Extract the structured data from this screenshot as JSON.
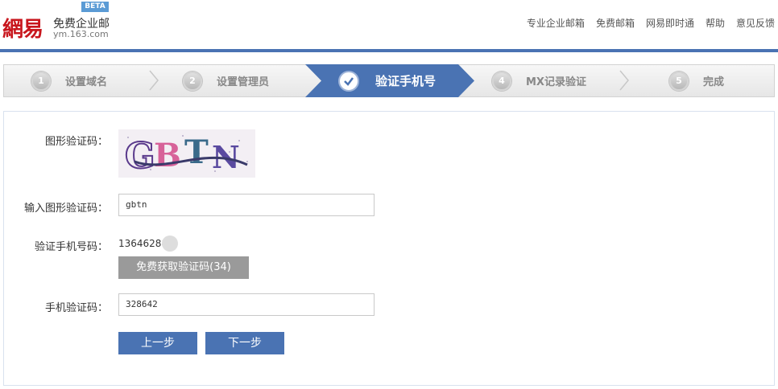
{
  "header": {
    "logo_text": "網易",
    "product_name": "免费企业邮",
    "domain": "ym.163.com",
    "beta_badge": "BETA",
    "nav": [
      "专业企业邮箱",
      "免费邮箱",
      "网易即时通",
      "帮助",
      "意见反馈"
    ]
  },
  "steps": [
    {
      "num": "1",
      "label": "设置域名"
    },
    {
      "num": "2",
      "label": "设置管理员"
    },
    {
      "num": "✓",
      "label": "验证手机号",
      "active": true
    },
    {
      "num": "4",
      "label": "MX记录验证"
    },
    {
      "num": "5",
      "label": "完成"
    }
  ],
  "form": {
    "captcha_image_label": "图形验证码：",
    "captcha_text": "GBTN",
    "captcha_input_label": "输入图形验证码：",
    "captcha_input_value": "gbtn",
    "phone_label": "验证手机号码：",
    "phone_value": "13646288  5",
    "sms_button": "免费获取验证码(34)",
    "sms_code_label": "手机验证码：",
    "sms_code_value": "328642",
    "prev_button": "上一步",
    "next_button": "下一步"
  },
  "colors": {
    "brand_red": "#c8161d",
    "accent_blue": "#4a73b3",
    "disabled_gray": "#9a9a9a"
  }
}
